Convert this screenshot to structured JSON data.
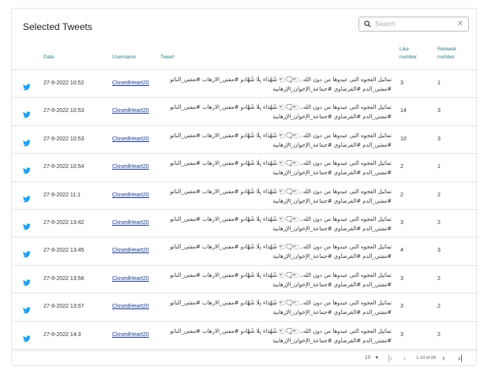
{
  "header": {
    "title": "Selected Tweets",
    "search_placeholder": "Search",
    "clear_glyph": "✕"
  },
  "columns": {
    "date": "Date",
    "username": "Username",
    "tweet": "Tweet",
    "like": "Like number",
    "retweet": "Retweet number"
  },
  "rows": [
    {
      "date": "27-9-2022 10:52",
      "username": "ClosedHeart20",
      "tweet": "تماثيل العجوه التي عبدوها من دون الله..🐑🗨️🐑 شُهَّدَاء بِلَا شُهَّادو #مفتي_الارهاب #مفتي_الناتو #مفتي_الدم #القرضاوي #جماعة_الإخوان_الإرهابية",
      "like": "3",
      "retweet": "1"
    },
    {
      "date": "27-9-2022 10:53",
      "username": "ClosedHeart20",
      "tweet": "تماثيل العجوه التي عبدوها من دون الله..🐑🗨️🐑 شُهَّدَاء بِلَا شُهَّادو #مفتي_الارهاب #مفتي_الناتو #مفتي_الدم #القرضاوي #جماعة_الإخوان_الإرهابية",
      "like": "14",
      "retweet": "3"
    },
    {
      "date": "27-9-2022 10:53",
      "username": "ClosedHeart20",
      "tweet": "تماثيل العجوه التي عبدوها من دون الله..🐑🗨️🐑 شُهَّدَاء بِلَا شُهَّادو #مفتي_الارهاب #مفتي_الناتو #مفتي_الدم #القرضاوي #جماعة_الإخوان_الإرهابية",
      "like": "10",
      "retweet": "3"
    },
    {
      "date": "27-9-2022 10:54",
      "username": "ClosedHeart20",
      "tweet": "تماثيل العجوه التي عبدوها من دون الله..🐑🗨️🐑 شُهَّدَاء بِلَا شُهَّادو #مفتي_الارهاب #مفتي_الناتو #مفتي_الدم #القرضاوي #جماعة_الإخوان_الإرهابية",
      "like": "2",
      "retweet": "1"
    },
    {
      "date": "27-9-2022 11:1",
      "username": "ClosedHeart20",
      "tweet": "تماثيل العجوه التي عبدوها من دون الله..🐑🗨️🐑 شُهَّدَاء بِلَا شُهَّادو #مفتي_الارهاب #مفتي_الناتو #مفتي_الدم #القرضاوي #جماعة_الإخوان_الإرهابية",
      "like": "2",
      "retweet": "2"
    },
    {
      "date": "27-9-2022 13:42",
      "username": "ClosedHeart20",
      "tweet": "تماثيل العجوه التي عبدوها من دون الله..🐑🗨️🐑 شُهَّدَاء بِلَا شُهَّادو #مفتي_الارهاب #مفتي_الناتو #مفتي_الدم #القرضاوي #جماعة_الإخوان_الإرهابية",
      "like": "3",
      "retweet": "2"
    },
    {
      "date": "27-9-2022 13:45",
      "username": "ClosedHeart20",
      "tweet": "تماثيل العجوه التي عبدوها من دون الله..🐑🗨️🐑 شُهَّدَاء بِلَا شُهَّادو #مفتي_الارهاب #مفتي_الناتو #مفتي_الدم #القرضاوي #جماعة_الإخوان_الإرهابية",
      "like": "4",
      "retweet": "3"
    },
    {
      "date": "27-9-2022 13:56",
      "username": "ClosedHeart20",
      "tweet": "تماثيل العجوه التي عبدوها من دون الله..🐑🗨️🐑 شُهَّدَاء بِلَا شُهَّادو #مفتي_الارهاب #مفتي_الناتو #مفتي_الدم #القرضاوي #جماعة_الإخوان_الإرهابية",
      "like": "3",
      "retweet": "2"
    },
    {
      "date": "27-9-2022 13:57",
      "username": "ClosedHeart20",
      "tweet": "تماثيل العجوه التي عبدوها من دون الله..🐑🗨️🐑 شُهَّدَاء بِلَا شُهَّادو #مفتي_الارهاب #مفتي_الناتو #مفتي_الدم #القرضاوي #جماعة_الإخوان_الإرهابية",
      "like": "3",
      "retweet": "2"
    },
    {
      "date": "27-9-2022 14:3",
      "username": "ClosedHeart20",
      "tweet": "تماثيل العجوه التي عبدوها من دون الله..🐑🗨️🐑 شُهَّدَاء بِلَا شُهَّادو #مفتي_الارهاب #مفتي_الناتو #مفتي_الدم #القرضاوي #جماعة_الإخوان_الإرهابية",
      "like": "3",
      "retweet": "2"
    }
  ],
  "pagination": {
    "rows_per_page": "10",
    "range": "1-10 of 28",
    "first_glyph": "|‹",
    "prev_glyph": "‹",
    "next_glyph": "›",
    "last_glyph": "›|"
  },
  "icons": {
    "row_icon": "twitter-bird-icon",
    "search": "search-icon",
    "twitter_color": "#1da1f2",
    "header_color": "#2a7a7e",
    "link_color": "#1b3a8c"
  }
}
